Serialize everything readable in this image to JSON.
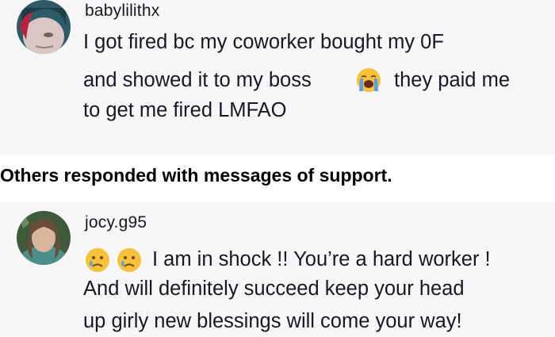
{
  "comments": [
    {
      "username": "babylilithx",
      "lines": [
        "I got fired bc my coworker bought my 0F",
        "and showed it to my boss",
        "they paid me",
        "to get me fired LMFAO"
      ],
      "emoji": "loudly-crying-face-icon"
    },
    {
      "username": "jocy.g95",
      "lines": [
        "I am in shock !! You’re a hard worker !",
        "And will definitely succeed keep your head",
        "up girly new blessings will come your way!"
      ],
      "emoji": "crying-face-icon"
    }
  ],
  "caption": "Others responded with messages of support.",
  "colors": {
    "text": "#161823",
    "comment_background": "#f7f7f7",
    "emoji_yellow": "#f7c23a",
    "tears_blue": "#5aa0e6"
  }
}
